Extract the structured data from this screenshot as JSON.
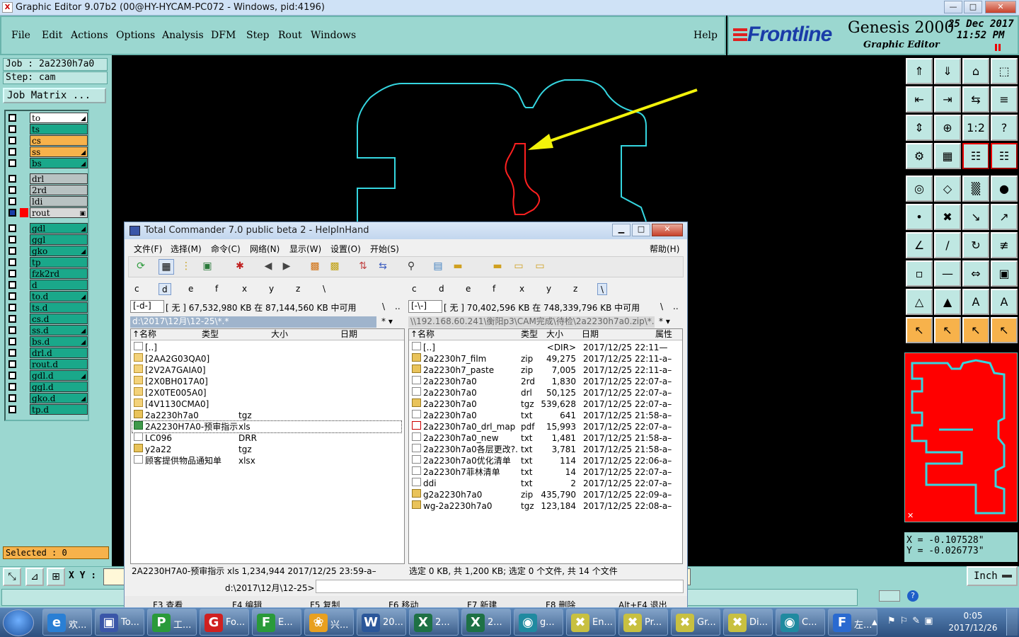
{
  "window": {
    "title": "Graphic Editor 9.07b2 (00@HY-HYCAM-PC072 - Windows, pid:4196)",
    "icon": "x-app-icon",
    "controls": [
      "—",
      "□",
      "✕"
    ]
  },
  "menu": {
    "items": [
      "File",
      "Edit",
      "Actions",
      "Options",
      "Analysis",
      "DFM",
      "Step",
      "Rout",
      "Windows"
    ],
    "help": "Help"
  },
  "brand": {
    "logo": "Frontline",
    "product": "Genesis 2000",
    "subtitle": "Graphic Editor",
    "date": "25 Dec 2017",
    "time": "11:52 PM"
  },
  "job": {
    "job_line": "Job : 2a2230h7a0",
    "step_line": "Step: cam",
    "matrix_button": "Job Matrix ..."
  },
  "layers": [
    {
      "name": "to",
      "color": "#ffffff",
      "mark": "◢"
    },
    {
      "name": "ts",
      "color": "#1aa88a",
      "mark": ""
    },
    {
      "name": "cs",
      "color": "#f7b24b",
      "mark": ""
    },
    {
      "name": "ss",
      "color": "#f7b24b",
      "mark": "◢"
    },
    {
      "name": "bs",
      "color": "#1aa88a",
      "mark": "◢"
    },
    {
      "name": "drl",
      "color": "#b8c2c2",
      "mark": ""
    },
    {
      "name": "2rd",
      "color": "#b8c2c2",
      "mark": ""
    },
    {
      "name": "ldi",
      "color": "#b8c2c2",
      "mark": ""
    },
    {
      "name": "rout",
      "color": "#d8d8d8",
      "mark": "▣"
    },
    {
      "name": "gdl",
      "color": "#1aa88a",
      "mark": "◢"
    },
    {
      "name": "ggl",
      "color": "#1aa88a",
      "mark": ""
    },
    {
      "name": "gko",
      "color": "#1aa88a",
      "mark": "◢"
    },
    {
      "name": "tp",
      "color": "#1aa88a",
      "mark": ""
    },
    {
      "name": "fzk2rd",
      "color": "#1aa88a",
      "mark": ""
    },
    {
      "name": "d",
      "color": "#1aa88a",
      "mark": ""
    },
    {
      "name": "to.d",
      "color": "#1aa88a",
      "mark": "◢"
    },
    {
      "name": "ts.d",
      "color": "#1aa88a",
      "mark": ""
    },
    {
      "name": "cs.d",
      "color": "#1aa88a",
      "mark": ""
    },
    {
      "name": "ss.d",
      "color": "#1aa88a",
      "mark": "◢"
    },
    {
      "name": "bs.d",
      "color": "#1aa88a",
      "mark": "◢"
    },
    {
      "name": "drl.d",
      "color": "#1aa88a",
      "mark": ""
    },
    {
      "name": "rout.d",
      "color": "#1aa88a",
      "mark": ""
    },
    {
      "name": "gdl.d",
      "color": "#1aa88a",
      "mark": "◢"
    },
    {
      "name": "ggl.d",
      "color": "#1aa88a",
      "mark": ""
    },
    {
      "name": "gko.d",
      "color": "#1aa88a",
      "mark": "◢"
    },
    {
      "name": "tp.d",
      "color": "#1aa88a",
      "mark": ""
    }
  ],
  "selected": "Selected : 0",
  "coords": {
    "x": "X = -0.107528\"",
    "y": "Y = -0.026773\""
  },
  "bottom": {
    "xy_label": "X Y :",
    "units": "Inch"
  },
  "total_commander": {
    "title": "Total Commander 7.0 public beta 2 - HelpInHand",
    "menu": [
      "文件(F)",
      "选择(M)",
      "命令(C)",
      "网络(N)",
      "显示(W)",
      "设置(O)",
      "开始(S)"
    ],
    "help": "帮助(H)",
    "left_drives": [
      "c",
      "d",
      "e",
      "f",
      "x",
      "y",
      "z",
      "\\"
    ],
    "right_drives": [
      "c",
      "d",
      "e",
      "f",
      "x",
      "y",
      "z",
      "\\"
    ],
    "left": {
      "drive_select": "[-d-]",
      "free": "[ 无 ]  67,532,980 KB 在 87,144,560 KB 中可用",
      "path": "d:\\2017\\12月\\12-25\\*.*",
      "headers": [
        "↑名称",
        "类型",
        "大小",
        "日期"
      ],
      "rows": [
        {
          "name": "[..]",
          "type": "",
          "icon": "up"
        },
        {
          "name": "[2AA2G03QA0]",
          "type": "",
          "icon": "folder"
        },
        {
          "name": "[2V2A7GAIA0]",
          "type": "",
          "icon": "folder"
        },
        {
          "name": "[2X0BH017A0]",
          "type": "",
          "icon": "folder"
        },
        {
          "name": "[2X0TE005A0]",
          "type": "",
          "icon": "folder"
        },
        {
          "name": "[4V1130CMA0]",
          "type": "",
          "icon": "folder"
        },
        {
          "name": "2a2230h7a0",
          "type": "tgz",
          "icon": "arc"
        },
        {
          "name": "2A2230H7A0-预审指示",
          "type": "xls",
          "icon": "xl"
        },
        {
          "name": "LC096",
          "type": "DRR",
          "icon": "file"
        },
        {
          "name": "y2a22",
          "type": "tgz",
          "icon": "arc"
        },
        {
          "name": "顾客提供物品通知单",
          "type": "xlsx",
          "icon": "file"
        }
      ],
      "status": "2A2230H7A0-预审指示        xls    1,234,944  2017/12/25 23:59-a–"
    },
    "right": {
      "drive_select": "[-\\-]",
      "free": "[ 无 ]  70,402,596 KB 在 748,339,796 KB 中可用",
      "path": "\\\\192.168.60.241\\衡阳p3\\CAM完成\\待检\\2a2230h7a0.zip\\*.*",
      "headers": [
        "↑名称",
        "类型",
        "大小",
        "日期",
        "属性"
      ],
      "rows": [
        {
          "name": "[..]",
          "type": "",
          "size": "<DIR>",
          "date": "2017/12/25 22:11—",
          "icon": "up"
        },
        {
          "name": "2a2230h7_film",
          "type": "zip",
          "size": "49,275",
          "date": "2017/12/25 22:11-a–",
          "icon": "arc"
        },
        {
          "name": "2a2230h7_paste",
          "type": "zip",
          "size": "7,005",
          "date": "2017/12/25 22:11-a–",
          "icon": "arc"
        },
        {
          "name": "2a2230h7a0",
          "type": "2rd",
          "size": "1,830",
          "date": "2017/12/25 22:07-a–",
          "icon": "file"
        },
        {
          "name": "2a2230h7a0",
          "type": "drl",
          "size": "50,125",
          "date": "2017/12/25 22:07-a–",
          "icon": "file"
        },
        {
          "name": "2a2230h7a0",
          "type": "tgz",
          "size": "539,628",
          "date": "2017/12/25 22:07-a–",
          "icon": "arc"
        },
        {
          "name": "2a2230h7a0",
          "type": "txt",
          "size": "641",
          "date": "2017/12/25 21:58-a–",
          "icon": "file"
        },
        {
          "name": "2a2230h7a0_drl_map",
          "type": "pdf",
          "size": "15,993",
          "date": "2017/12/25 22:07-a–",
          "icon": "pdf"
        },
        {
          "name": "2a2230h7a0_new",
          "type": "txt",
          "size": "1,481",
          "date": "2017/12/25 21:58-a–",
          "icon": "file"
        },
        {
          "name": "2a2230h7a0各层更改?.",
          "type": "txt",
          "size": "3,781",
          "date": "2017/12/25 21:58-a–",
          "icon": "file"
        },
        {
          "name": "2a2230h7a0优化清单",
          "type": "txt",
          "size": "114",
          "date": "2017/12/25 22:06-a–",
          "icon": "file"
        },
        {
          "name": "2a2230h7菲林清单",
          "type": "txt",
          "size": "14",
          "date": "2017/12/25 22:07-a–",
          "icon": "file"
        },
        {
          "name": "ddi",
          "type": "txt",
          "size": "2",
          "date": "2017/12/25 22:07-a–",
          "icon": "file"
        },
        {
          "name": "g2a2230h7a0",
          "type": "zip",
          "size": "435,790",
          "date": "2017/12/25 22:09-a–",
          "icon": "arc"
        },
        {
          "name": "wg-2a2230h7a0",
          "type": "tgz",
          "size": "123,184",
          "date": "2017/12/25 22:08-a–",
          "icon": "arc"
        }
      ],
      "status": "选定 0 KB, 共 1,200 KB; 选定 0 个文件, 共 14 个文件"
    },
    "cmd_path": "d:\\2017\\12月\\12-25>",
    "fkeys": [
      "F3 查看",
      "F4 编辑",
      "F5 复制",
      "F6 移动",
      "F7 新建",
      "F8 删除",
      "Alt+F4 退出"
    ]
  },
  "taskbar": {
    "tasks": [
      {
        "label": "欢...",
        "icon": "ie-icon",
        "glyph": "e",
        "color": "#2a7fd4"
      },
      {
        "label": "To...",
        "icon": "floppy-icon",
        "glyph": "▣",
        "color": "#3a56a8"
      },
      {
        "label": "工...",
        "icon": "green-p-icon",
        "glyph": "P",
        "color": "#2a9a3a"
      },
      {
        "label": "Fo...",
        "icon": "foxmail-icon",
        "glyph": "G",
        "color": "#d02020"
      },
      {
        "label": "E...",
        "icon": "green-f-icon",
        "glyph": "F",
        "color": "#2a9a3a"
      },
      {
        "label": "兴...",
        "icon": "shell-icon",
        "glyph": "❀",
        "color": "#e8a020"
      },
      {
        "label": "20...",
        "icon": "word-icon",
        "glyph": "W",
        "color": "#2b579a"
      },
      {
        "label": "2...",
        "icon": "excel-icon",
        "glyph": "X",
        "color": "#1e7145"
      },
      {
        "label": "2...",
        "icon": "excel-icon",
        "glyph": "X",
        "color": "#1e7145"
      },
      {
        "label": "g...",
        "icon": "eye-icon",
        "glyph": "◉",
        "color": "#208aa0"
      },
      {
        "label": "En...",
        "icon": "genesis-x-icon",
        "glyph": "✖",
        "color": "#c8c040"
      },
      {
        "label": "Pr...",
        "icon": "genesis-x-icon",
        "glyph": "✖",
        "color": "#c8c040"
      },
      {
        "label": "Gr...",
        "icon": "genesis-x-icon",
        "glyph": "✖",
        "color": "#c8c040"
      },
      {
        "label": "Di...",
        "icon": "genesis-x-icon",
        "glyph": "✖",
        "color": "#c8c040"
      },
      {
        "label": "C...",
        "icon": "eye-icon",
        "glyph": "◉",
        "color": "#208aa0"
      },
      {
        "label": "左...",
        "icon": "frontline-icon",
        "glyph": "F",
        "color": "#2a6ad0"
      }
    ],
    "time": "0:05",
    "date": "2017/12/26"
  },
  "right_tools": [
    "⇑",
    "⇓",
    "⌂",
    "⬚",
    "⇤",
    "⇥",
    "⇆",
    "≡",
    "⇕",
    "⊕",
    "1:2",
    "?",
    "⚙",
    "▦",
    "☷",
    "☷",
    "◎",
    "◇",
    "▒",
    "●",
    "•",
    "✖",
    "↘",
    "↗",
    "∠",
    "∕",
    "↻",
    "≢",
    "▫",
    "—",
    "⇔",
    "▣",
    "△",
    "▲",
    "A",
    "A",
    "↖",
    "↖",
    "↖",
    "↖"
  ]
}
